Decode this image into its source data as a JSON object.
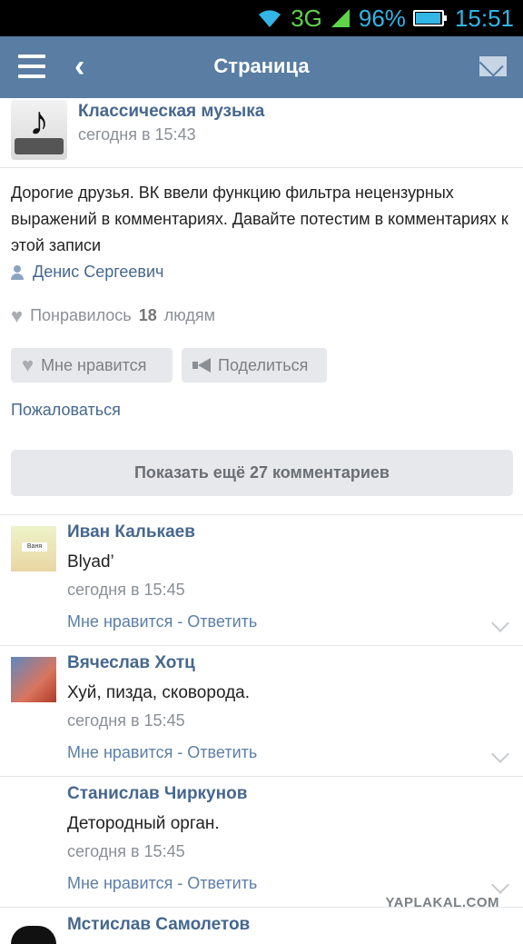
{
  "status_bar": {
    "network": "3G",
    "battery_percent": "96%",
    "battery_level": 0.96,
    "time": "15:51",
    "icons": [
      "wifi-icon",
      "signal-icon",
      "battery-icon"
    ]
  },
  "app_bar": {
    "title": "Страница",
    "icons": [
      "menu-icon",
      "back-arrow-icon",
      "mail-icon"
    ]
  },
  "post": {
    "group_name": "Классическая музыка",
    "time": "сегодня в 15:43",
    "text": "Дорогие друзья. ВК ввели функцию фильтра нецензурных выражений в комментариях. Давайте потестим в комментариях к этой записи",
    "author": "Денис Сергеевич",
    "likes_prefix": "Понравилось",
    "likes_count": "18",
    "likes_suffix": "людям",
    "like_button": "Мне нравится",
    "share_button": "Поделиться",
    "report_link": "Пожаловаться",
    "more_comments": "Показать ещё 27 комментариев"
  },
  "comments": [
    {
      "name": "Иван Калькаев",
      "text": "Blyad’",
      "time": "сегодня в 15:45",
      "actions": "Мне нравится - Ответить",
      "avatar_label": "Ваня"
    },
    {
      "name": "Вячеслав Хотц",
      "text": "Хуй, пизда, сковорода.",
      "time": "сегодня в 15:45",
      "actions": "Мне нравится - Ответить"
    },
    {
      "name": "Станислав Чиркунов",
      "text": "Детородный орган.",
      "time": "сегодня в 15:45",
      "actions": "Мне нравится - Ответить"
    },
    {
      "name": "Мстислав Самолетов"
    }
  ],
  "watermark": "YAPLAKAL.COM",
  "colors": {
    "app_bar": "#597da3",
    "link": "#45678f",
    "status_accent": "#33b5e5"
  }
}
